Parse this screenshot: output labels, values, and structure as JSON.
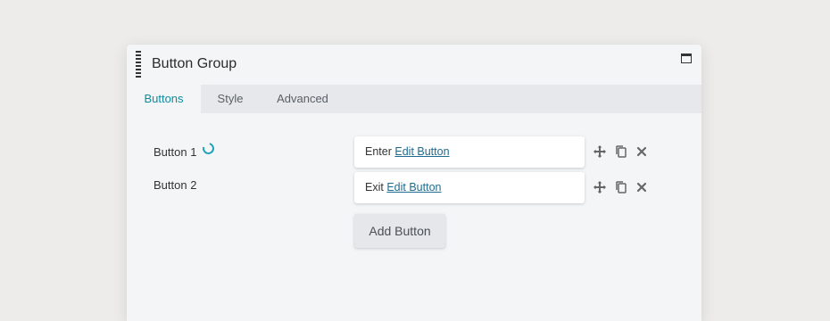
{
  "panel": {
    "title": "Button Group",
    "icons": {
      "handle": "drag-handle-icon",
      "maximize": "maximize-icon"
    }
  },
  "tabs": [
    {
      "label": "Buttons",
      "active": true
    },
    {
      "label": "Style",
      "active": false
    },
    {
      "label": "Advanced",
      "active": false
    }
  ],
  "buttons": [
    {
      "label": "Button 1",
      "text": "Enter",
      "link": "Edit Button",
      "loading": true
    },
    {
      "label": "Button 2",
      "text": "Exit",
      "link": "Edit Button",
      "loading": false
    }
  ],
  "add_button": {
    "label": "Add Button"
  },
  "row_actions": [
    "move-icon",
    "copy-icon",
    "close-icon"
  ],
  "colors": {
    "accent": "#0f8b9f",
    "link": "#1e6b8f",
    "background": "#edecea",
    "panel": "#f4f5f7"
  }
}
